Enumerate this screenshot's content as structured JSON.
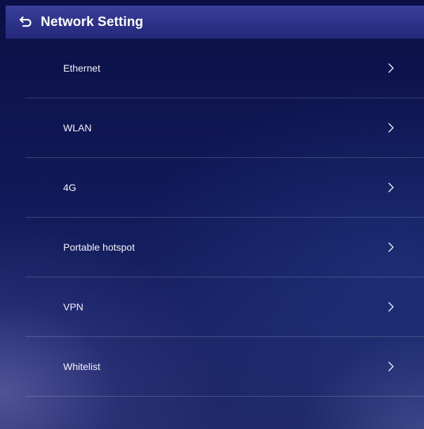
{
  "header": {
    "title": "Network Setting",
    "back_icon": "back-arrow-icon"
  },
  "menu": {
    "items": [
      {
        "label": "Ethernet",
        "icon": "chevron-right-icon"
      },
      {
        "label": "WLAN",
        "icon": "chevron-right-icon"
      },
      {
        "label": "4G",
        "icon": "chevron-right-icon"
      },
      {
        "label": "Portable hotspot",
        "icon": "chevron-right-icon"
      },
      {
        "label": "VPN",
        "icon": "chevron-right-icon"
      },
      {
        "label": "Whitelist",
        "icon": "chevron-right-icon"
      }
    ]
  },
  "colors": {
    "header_bg": "#2c3288",
    "background": "#111a58",
    "text": "#ffffff"
  }
}
